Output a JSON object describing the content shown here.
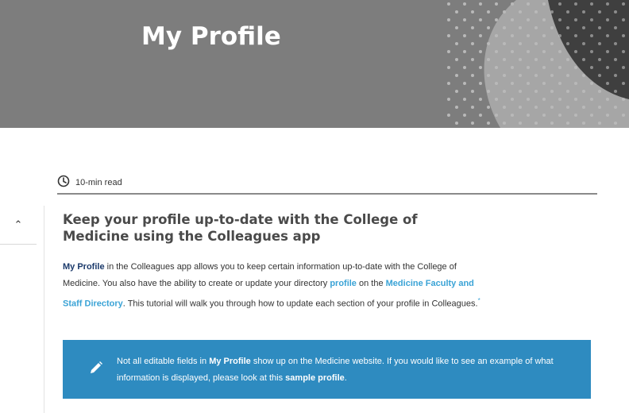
{
  "hero": {
    "title": "My Profile"
  },
  "meta": {
    "read_time": "10-min read",
    "icon": "clock-icon"
  },
  "sidebar": {
    "toggle_icon": "chevron-up-icon"
  },
  "article": {
    "heading": "Keep your profile up-to-date with the College of Medicine using the Colleagues app",
    "intro": {
      "strong_lead": "My Profile",
      "text1": " in the Colleagues app allows you to keep certain information up-to-date with the College of Medicine. You also have the ability to create or update your directory ",
      "link_profile": "profile",
      "text2": " on the ",
      "link_directory": "Medicine Faculty and Staff Directory",
      "text3": ". This tutorial will walk you through how to update each section of your profile in Colleagues.",
      "footnote_mark": "*"
    }
  },
  "callout": {
    "icon": "pencil-icon",
    "text1": "Not all editable fields in ",
    "strong1": "My Profile",
    "text2": " show up on the Medicine website. If you would like to see an example of what information is displayed, please look at this ",
    "strong2": "sample profile",
    "text3": "."
  },
  "colors": {
    "hero_bg": "#7d7d7d",
    "callout_bg": "#2e8bc0",
    "link": "#3aa3d6",
    "strong_text": "#1b3a6b"
  }
}
